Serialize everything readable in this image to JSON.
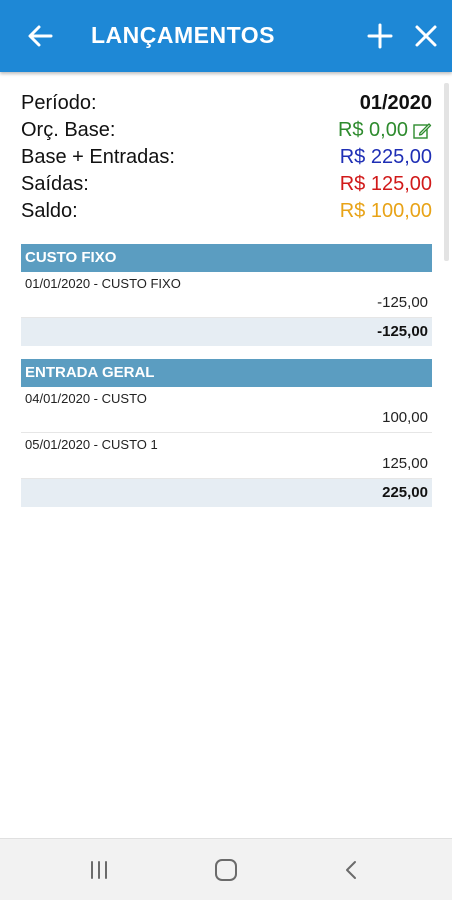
{
  "appbar": {
    "title": "LANÇAMENTOS",
    "color": "#1e88d6",
    "back_icon": "arrow-left-icon",
    "add_icon": "plus-icon",
    "close_icon": "close-icon"
  },
  "summary": {
    "period_label": "Período:",
    "period_value": "01/2020",
    "base_label": "Orç. Base:",
    "base_value": "R$ 0,00",
    "base_edit_icon": "edit-icon",
    "incoming_label": "Base + Entradas:",
    "incoming_value": "R$ 225,00",
    "outgoing_label": "Saídas:",
    "outgoing_value": "R$ 125,00",
    "balance_label": "Saldo:",
    "balance_value": "R$ 100,00",
    "colors": {
      "base": "#2e8b2e",
      "incoming": "#1f2fb5",
      "outgoing": "#d11a1a",
      "balance": "#e8a317"
    }
  },
  "groups": [
    {
      "name": "CUSTO FIXO",
      "entries": [
        {
          "desc": "01/01/2020 - CUSTO FIXO",
          "amount": "-125,00"
        }
      ],
      "total": "-125,00"
    },
    {
      "name": "ENTRADA GERAL",
      "entries": [
        {
          "desc": "04/01/2020 - CUSTO",
          "amount": "100,00"
        },
        {
          "desc": "05/01/2020 - CUSTO 1",
          "amount": "125,00"
        }
      ],
      "total": "225,00"
    }
  ],
  "navbar": {
    "recent_icon": "recent-apps-icon",
    "home_icon": "home-icon",
    "back_icon": "back-chevron-icon"
  }
}
